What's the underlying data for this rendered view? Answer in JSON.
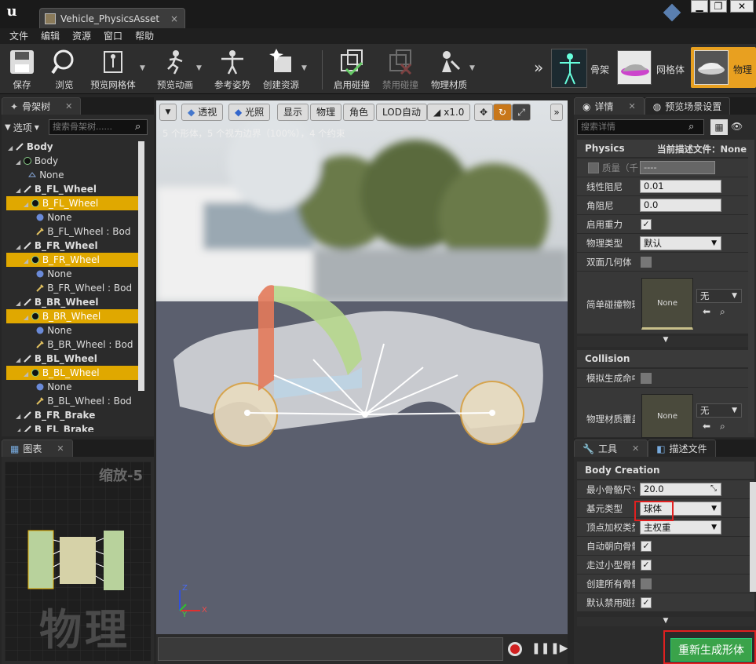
{
  "title_bar": {
    "tab_title": "Vehicle_PhysicsAsset",
    "close": "×",
    "minimize": "▁",
    "restore": "❐",
    "close_window": "✕"
  },
  "menu": [
    "文件",
    "编辑",
    "资源",
    "窗口",
    "帮助"
  ],
  "toolbar": {
    "save": "保存",
    "browse": "浏览",
    "preview_mesh": "预览网格体",
    "preview_anim": "预览动画",
    "ref_pose": "参考姿势",
    "create_asset": "创建资源",
    "enable_collision": "启用碰撞",
    "disable_collision": "禁用碰撞",
    "physics_material": "物理材质",
    "mode_skeleton": "骨架",
    "mode_mesh": "网格体",
    "mode_physics": "物理"
  },
  "skeleton_tree": {
    "tab": "骨架树",
    "options": "选项",
    "search_placeholder": "搜索骨架树......",
    "rows": [
      {
        "text": "Body",
        "bold": true,
        "hl": false,
        "ind": 0,
        "icon": "bone"
      },
      {
        "text": "Body",
        "bold": false,
        "hl": false,
        "ind": 1,
        "icon": "body"
      },
      {
        "text": "None",
        "bold": false,
        "hl": false,
        "ind": 2,
        "icon": "shape"
      },
      {
        "text": "B_FL_Wheel",
        "bold": true,
        "hl": false,
        "ind": 1,
        "icon": "bone"
      },
      {
        "text": "B_FL_Wheel",
        "bold": false,
        "hl": true,
        "ind": 2,
        "icon": "body"
      },
      {
        "text": "None",
        "bold": false,
        "hl": false,
        "ind": 3,
        "icon": "sphere"
      },
      {
        "text": "B_FL_Wheel : Bod",
        "bold": false,
        "hl": false,
        "ind": 3,
        "icon": "constraint"
      },
      {
        "text": "B_FR_Wheel",
        "bold": true,
        "hl": false,
        "ind": 1,
        "icon": "bone"
      },
      {
        "text": "B_FR_Wheel",
        "bold": false,
        "hl": true,
        "ind": 2,
        "icon": "body"
      },
      {
        "text": "None",
        "bold": false,
        "hl": false,
        "ind": 3,
        "icon": "sphere"
      },
      {
        "text": "B_FR_Wheel : Bod",
        "bold": false,
        "hl": false,
        "ind": 3,
        "icon": "constraint"
      },
      {
        "text": "B_BR_Wheel",
        "bold": true,
        "hl": false,
        "ind": 1,
        "icon": "bone"
      },
      {
        "text": "B_BR_Wheel",
        "bold": false,
        "hl": true,
        "ind": 2,
        "icon": "body"
      },
      {
        "text": "None",
        "bold": false,
        "hl": false,
        "ind": 3,
        "icon": "sphere"
      },
      {
        "text": "B_BR_Wheel : Bod",
        "bold": false,
        "hl": false,
        "ind": 3,
        "icon": "constraint"
      },
      {
        "text": "B_BL_Wheel",
        "bold": true,
        "hl": false,
        "ind": 1,
        "icon": "bone"
      },
      {
        "text": "B_BL_Wheel",
        "bold": false,
        "hl": true,
        "ind": 2,
        "icon": "body"
      },
      {
        "text": "None",
        "bold": false,
        "hl": false,
        "ind": 3,
        "icon": "sphere"
      },
      {
        "text": "B_BL_Wheel : Bod",
        "bold": false,
        "hl": false,
        "ind": 3,
        "icon": "constraint"
      },
      {
        "text": "B_FR_Brake",
        "bold": true,
        "hl": false,
        "ind": 1,
        "icon": "bone"
      },
      {
        "text": "B_FL_Brake",
        "bold": true,
        "hl": false,
        "ind": 1,
        "icon": "bone"
      }
    ]
  },
  "graph": {
    "tab": "图表",
    "zoom": "缩放-5",
    "watermark": "物理"
  },
  "viewport": {
    "perspective": "透视",
    "lit": "光照",
    "show": "显示",
    "physics": "物理",
    "character": "角色",
    "lod": "LOD自动",
    "speed": "x1.0",
    "stats": "5 个形体，5 个视为边界（100%），4 个约束",
    "axis_z": "Z",
    "axis_x": "X",
    "axis_y": "Y"
  },
  "details": {
    "tab": "详情",
    "tab2": "预览场景设置",
    "search_placeholder": "搜索详情",
    "physics_header": "Physics",
    "profile_label": "当前描述文件：None",
    "mass_label": "质量（千",
    "mass_value": "----",
    "linear_damping_label": "线性阻尼",
    "linear_damping": "0.01",
    "angular_damping_label": "角阻尼",
    "angular_damping": "0.0",
    "enable_gravity_label": "启用重力",
    "physics_type_label": "物理类型",
    "physics_type": "默认",
    "double_sided_label": "双面几何体",
    "simple_collision_label": "简单碰撞物理",
    "thumb_none": "None",
    "none_option": "无",
    "collision_header": "Collision",
    "sim_gen_label": "模拟生成命中",
    "phys_mat_override_label": "物理材质覆盖",
    "thumb_none2": "None",
    "none_option2": "无"
  },
  "tools": {
    "tab": "工具",
    "tab2": "描述文件",
    "body_creation": "Body Creation",
    "min_bone_size_label": "最小骨骼尺寸",
    "min_bone_size": "20.0",
    "primitive_type_label": "基元类型",
    "primitive_type": "球体",
    "vertex_weight_label": "顶点加权类型",
    "vertex_weight": "主权重",
    "auto_orient_label": "自动朝向骨骼",
    "walk_small_label": "走过小型骨骼",
    "create_all_label": "创建所有骨骼",
    "default_disable_label": "默认禁用碰撞",
    "regenerate": "重新生成形体"
  }
}
